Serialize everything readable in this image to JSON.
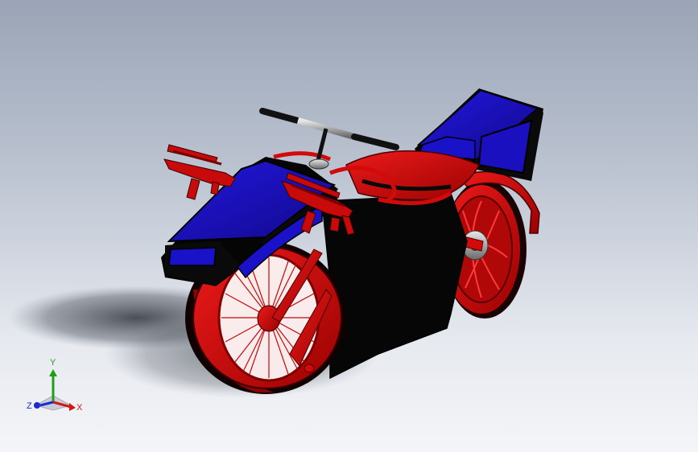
{
  "viewport": {
    "background": [
      "#9aa4b6",
      "#f4f5f8"
    ],
    "model": {
      "colors": {
        "body_blue": "#1a12c8",
        "frame_red": "#d20a0a",
        "dark_red": "#8a0000",
        "black": "#070707",
        "chrome": "#9c9c9c"
      }
    }
  },
  "triad": {
    "x_label": "X",
    "y_label": "Y",
    "z_label": "Z",
    "colors": {
      "x": "#d01818",
      "y": "#1ca01c",
      "z": "#1a2bd0"
    }
  }
}
